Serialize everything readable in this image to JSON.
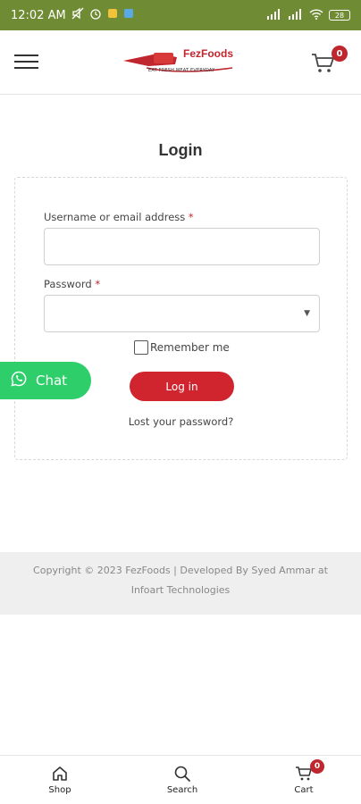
{
  "status_bar": {
    "time": "12:02 AM",
    "battery": "28"
  },
  "header": {
    "brand": "FezFoods",
    "tagline": "EAT FRESH MEAT EVERYDAY",
    "cart_count": "0"
  },
  "login": {
    "title": "Login",
    "username_label": "Username or email address",
    "required_mark": "*",
    "password_label": "Password",
    "remember_label": "Remember me",
    "submit_label": "Log in",
    "lost_password": "Lost your password?"
  },
  "chat": {
    "label": "Chat"
  },
  "footer": {
    "copyright": "Copyright © 2023 FezFoods | Developed By Syed Ammar at Infoart Technologies"
  },
  "bottom_nav": {
    "shop": "Shop",
    "search": "Search",
    "cart": "Cart",
    "cart_count": "0"
  },
  "colors": {
    "status_bar": "#6f8b33",
    "brand_red": "#c0262d",
    "chat_green": "#2ecf6b",
    "footer_bg": "#efefef"
  }
}
